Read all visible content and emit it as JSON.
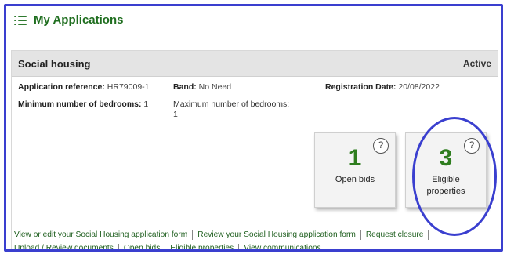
{
  "header": {
    "title": "My Applications",
    "menu_icon": "hamburger-menu-icon"
  },
  "application": {
    "name": "Social housing",
    "status": "Active",
    "reference_label": "Application reference:",
    "reference_value": "HR79009-1",
    "band_label": "Band:",
    "band_value": "No Need",
    "registration_label": "Registration Date:",
    "registration_value": "20/08/2022",
    "min_bedrooms_label": "Minimum number of bedrooms:",
    "min_bedrooms_value": "1",
    "max_bedrooms_label": "Maximum number of bedrooms:",
    "max_bedrooms_value": "1"
  },
  "cards": {
    "open_bids": {
      "count": "1",
      "label": "Open bids",
      "help": "?"
    },
    "eligible": {
      "count": "3",
      "label_line1": "Eligible",
      "label_line2": "properties",
      "help": "?"
    }
  },
  "links": {
    "row1": [
      "View or edit your Social Housing application form",
      "Review your Social Housing application form",
      "Request closure"
    ],
    "row2": [
      "Upload / Review documents",
      "Open bids",
      "Eligible properties",
      "View communications"
    ]
  },
  "colors": {
    "accent_green": "#2e7d1e",
    "annotation_blue": "#3a3fcf"
  }
}
